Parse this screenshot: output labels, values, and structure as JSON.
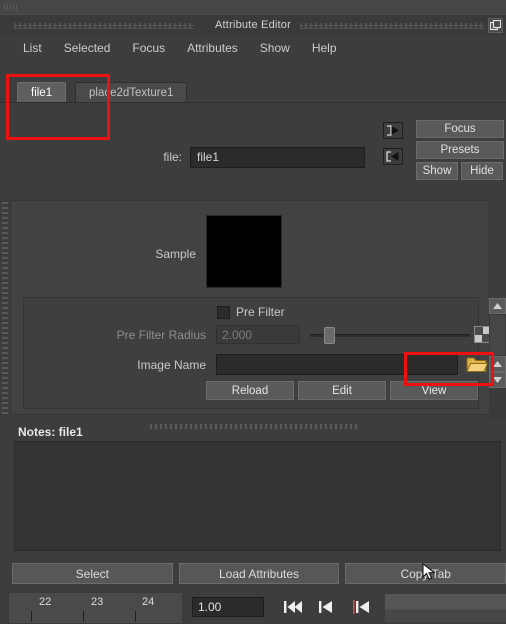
{
  "window": {
    "title": "Attribute Editor",
    "undock_icon": "undock-icon"
  },
  "menubar": {
    "items": [
      {
        "label": "List"
      },
      {
        "label": "Selected"
      },
      {
        "label": "Focus"
      },
      {
        "label": "Attributes"
      },
      {
        "label": "Show"
      },
      {
        "label": "Help"
      }
    ]
  },
  "tabs": [
    {
      "label": "file1",
      "active": true
    },
    {
      "label": "place2dTexture1",
      "active": false
    }
  ],
  "side_buttons": {
    "focus_label": "Focus",
    "presets_label": "Presets",
    "show_label": "Show",
    "hide_label": "Hide",
    "arrow_in_icon": "arrow-into-box-icon",
    "arrow_out_icon": "arrow-out-of-box-icon"
  },
  "file_row": {
    "label": "file:",
    "value": "file1"
  },
  "sample": {
    "label": "Sample",
    "swatch_color": "#000000"
  },
  "pre_filter": {
    "label": "Pre Filter",
    "checked": false,
    "radius_label": "Pre Filter Radius",
    "radius_value": "2.000",
    "map_button_icon": "texture-map-icon"
  },
  "image_name": {
    "label": "Image Name",
    "value": "",
    "folder_icon": "folder-open-icon"
  },
  "file_buttons": [
    {
      "label": "Reload"
    },
    {
      "label": "Edit"
    },
    {
      "label": "View"
    }
  ],
  "scrollbar": {
    "up_icon": "chevron-up-icon",
    "down_icon": "chevron-down-icon"
  },
  "notes": {
    "header": "Notes: file1",
    "value": ""
  },
  "bottom_buttons": [
    {
      "label": "Select"
    },
    {
      "label": "Load Attributes"
    },
    {
      "label": "Copy Tab"
    }
  ],
  "timeline": {
    "frames": [
      "22",
      "23",
      "24"
    ],
    "field_value": "1.00",
    "transport": [
      {
        "icon": "skip-to-start-icon"
      },
      {
        "icon": "step-back-icon"
      },
      {
        "icon": "play-backwards-icon"
      }
    ]
  },
  "colors": {
    "annotation": "#ee1111",
    "panel_bg": "#424242",
    "window_bg": "#3d3d3d",
    "button_bg": "#5a5a5a",
    "input_bg": "#2b2b2b",
    "folder": "#e8c35a"
  }
}
